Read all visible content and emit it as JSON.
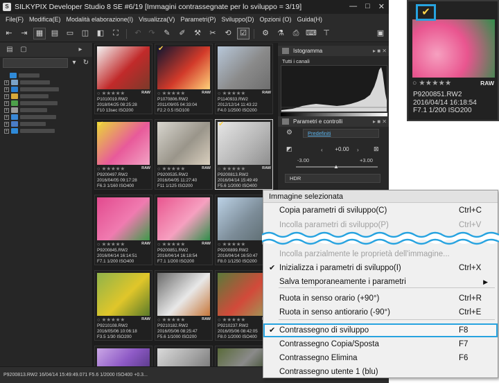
{
  "window": {
    "title": "SILKYPIX Developer Studio 8 SE  #6/19 [Immagini contrassegnate per lo sviluppo = 3/19]",
    "logo_letter": "S",
    "buttons": [
      "—",
      "□",
      "✕"
    ]
  },
  "menu": [
    "File(F)",
    "Modifica(E)",
    "Modalità elaborazione(I)",
    "Visualizza(V)",
    "Parametri(P)",
    "Sviluppo(D)",
    "Opzioni (O)",
    "Guida(H)"
  ],
  "left_panel": {
    "tree_rows": [
      {
        "plus": "",
        "color": "#2f8ad8"
      },
      {
        "plus": "+",
        "color": "#7aa3c9"
      },
      {
        "plus": "+",
        "color": "#2a7fd1"
      },
      {
        "plus": "+",
        "color": "#d8a93a"
      },
      {
        "plus": "+",
        "color": "#4da04a"
      },
      {
        "plus": "+",
        "color": "#9a9a9a"
      },
      {
        "plus": "+",
        "color": "#3a88d6"
      },
      {
        "plus": "+",
        "color": "#4a7dc6"
      },
      {
        "plus": "+",
        "color": "#2f8ad8"
      }
    ]
  },
  "thumbnails": [
    {
      "name": "P1010019.RW2",
      "date": "2018/04/25 08:25:28",
      "exif": "F10 13sec ISO200",
      "checked": false,
      "selected": false,
      "colors": [
        "#f3f3f3",
        "#c12a2a",
        "#7a3a2a"
      ]
    },
    {
      "name": "P1070806.RW2",
      "date": "2011/09/05 04:33:04",
      "exif": "F2.2 0.5 ISO100",
      "checked": true,
      "selected": false,
      "colors": [
        "#0f1630",
        "#d23a2a",
        "#ffd27a"
      ]
    },
    {
      "name": "P1140933.RW2",
      "date": "2012/12/14 11:43:22",
      "exif": "F4.0 1/2500 ISO200",
      "checked": false,
      "selected": false,
      "colors": [
        "#b7c7d9",
        "#8a8a8a",
        "#6e6e6e"
      ]
    },
    {
      "name": "P9200497.RW2",
      "date": "2016/04/05 09:17:28",
      "exif": "F6.3 1/160 ISO400",
      "checked": true,
      "selected": false,
      "colors": [
        "#e9d836",
        "#e85a9a",
        "#f2a3c4"
      ]
    },
    {
      "name": "P9200535.RW2",
      "date": "2016/04/05 11:27:40",
      "exif": "F11 1/125 ISO200",
      "checked": false,
      "selected": false,
      "colors": [
        "#d8d6cf",
        "#9a958a",
        "#d9cfbe"
      ]
    },
    {
      "name": "P9200813.RW2",
      "date": "2016/04/14 15:49:49",
      "exif": "F5.6 1/2000 ISO400",
      "checked": true,
      "selected": true,
      "colors": [
        "#e6e6e6",
        "#b9b9b9",
        "#8f8f8f"
      ]
    },
    {
      "name": "P9200845.RW2",
      "date": "2016/04/14 16:14:51",
      "exif": "F7.1 1/200 ISO400",
      "checked": false,
      "selected": false,
      "colors": [
        "#e24a8e",
        "#f07bb0",
        "#3e9a4a"
      ]
    },
    {
      "name": "P9200851.RW2",
      "date": "2016/04/14 16:18:54",
      "exif": "F7.1 1/200 ISO200",
      "checked": false,
      "selected": false,
      "colors": [
        "#e9558f",
        "#f6a0c0",
        "#2f8f4a"
      ]
    },
    {
      "name": "P9200899.RW2",
      "date": "2016/04/14 16:50:47",
      "exif": "F8.0 1/1250 ISO200",
      "checked": false,
      "selected": false,
      "colors": [
        "#bcd2e6",
        "#7c8c98",
        "#5b6a6e"
      ]
    },
    {
      "name": "P9210108.RW2",
      "date": "2016/05/06 10:06:18",
      "exif": "F3.5 1/30 ISO200",
      "checked": false,
      "selected": false,
      "colors": [
        "#8fb34a",
        "#e0c62a",
        "#5a7a2a"
      ]
    },
    {
      "name": "P9210182.RW2",
      "date": "2016/05/06 08:25:47",
      "exif": "F5.6 1/1000 ISO200",
      "checked": false,
      "selected": false,
      "colors": [
        "#6a6a6a",
        "#e8e8e8",
        "#c7773a"
      ]
    },
    {
      "name": "P9210237.RW2",
      "date": "2016/05/06 08:42:05",
      "exif": "F8.0 1/2000 ISO400",
      "checked": false,
      "selected": false,
      "colors": [
        "#5a7a3a",
        "#d24a3a",
        "#9aa05a"
      ]
    },
    {
      "name": "",
      "date": "",
      "exif": "",
      "checked": false,
      "selected": false,
      "colors": [
        "#caa7e6",
        "#8e5ac6",
        "#5a3a8a"
      ]
    },
    {
      "name": "",
      "date": "",
      "exif": "",
      "checked": false,
      "selected": false,
      "colors": [
        "#dadada",
        "#a8a8a8",
        "#7a7a7a"
      ]
    },
    {
      "name": "",
      "date": "",
      "exif": "",
      "checked": false,
      "selected": false,
      "colors": [
        "#5a6b3a",
        "#8a8a8a",
        "#3a4a2a"
      ]
    }
  ],
  "thumb_common": {
    "stars": "○ ★★★★★",
    "raw": "RAW",
    "check": "✔"
  },
  "right_panel": {
    "histogram_title": "Istogramma",
    "channel": "Tutti i canali",
    "params_title": "Parametri e controlli",
    "preset": "Predefiniti",
    "exposure": "+0.00",
    "min": "-3.00",
    "max": "+3.00",
    "hdr": "HDR"
  },
  "status": "P9200813.RW2 16/04/14 15:49:49.071 F5.6 1/2000 ISO400 +0.3...",
  "context_menu": {
    "header": "Immagine selezionata",
    "items": [
      {
        "label": "Copia parametri di sviluppo(C)",
        "shortcut": "Ctrl+C",
        "disabled": false,
        "checked": false,
        "submenu": false,
        "highlighted": false
      },
      {
        "label": "Incolla parametri di sviluppo(P)",
        "shortcut": "Ctrl+V",
        "disabled": true,
        "checked": false,
        "submenu": false,
        "highlighted": false
      },
      {
        "label": "Incolla parzialmente le proprietà dell'immagine...",
        "shortcut": "",
        "disabled": true,
        "checked": false,
        "submenu": false,
        "highlighted": false
      },
      {
        "label": "Inizializza i parametri di sviluppo(I)",
        "shortcut": "Ctrl+X",
        "disabled": false,
        "checked": true,
        "submenu": false,
        "highlighted": false
      },
      {
        "label": "Salva temporaneamente i parametri",
        "shortcut": "",
        "disabled": false,
        "checked": false,
        "submenu": true,
        "highlighted": false
      },
      {
        "label": "Ruota in senso orario (+90°)",
        "shortcut": "Ctrl+R",
        "disabled": false,
        "checked": false,
        "submenu": false,
        "highlighted": false
      },
      {
        "label": "Ruota in senso antiorario (-90°)",
        "shortcut": "Ctrl+E",
        "disabled": false,
        "checked": false,
        "submenu": false,
        "highlighted": false
      },
      {
        "label": "Contrassegno di sviluppo",
        "shortcut": "F8",
        "disabled": false,
        "checked": true,
        "submenu": false,
        "highlighted": true
      },
      {
        "label": "Contrassegno Copia/Sposta",
        "shortcut": "F7",
        "disabled": false,
        "checked": false,
        "submenu": false,
        "highlighted": false
      },
      {
        "label": "Contrassegno Elimina",
        "shortcut": "F6",
        "disabled": false,
        "checked": false,
        "submenu": false,
        "highlighted": false
      },
      {
        "label": "Contrassegno utente 1 (blu)",
        "shortcut": "",
        "disabled": false,
        "checked": false,
        "submenu": false,
        "highlighted": false
      }
    ]
  },
  "zoom_preview": {
    "name": "P9200851.RW2",
    "date": "2016/04/14 16:18:54",
    "exif": "F7.1 1/200 ISO200",
    "stars": "○ ★★★★★",
    "raw": "RAW",
    "check": "✔",
    "colors": [
      "#e9558f",
      "#f6a0c0",
      "#2f8f4a"
    ]
  }
}
